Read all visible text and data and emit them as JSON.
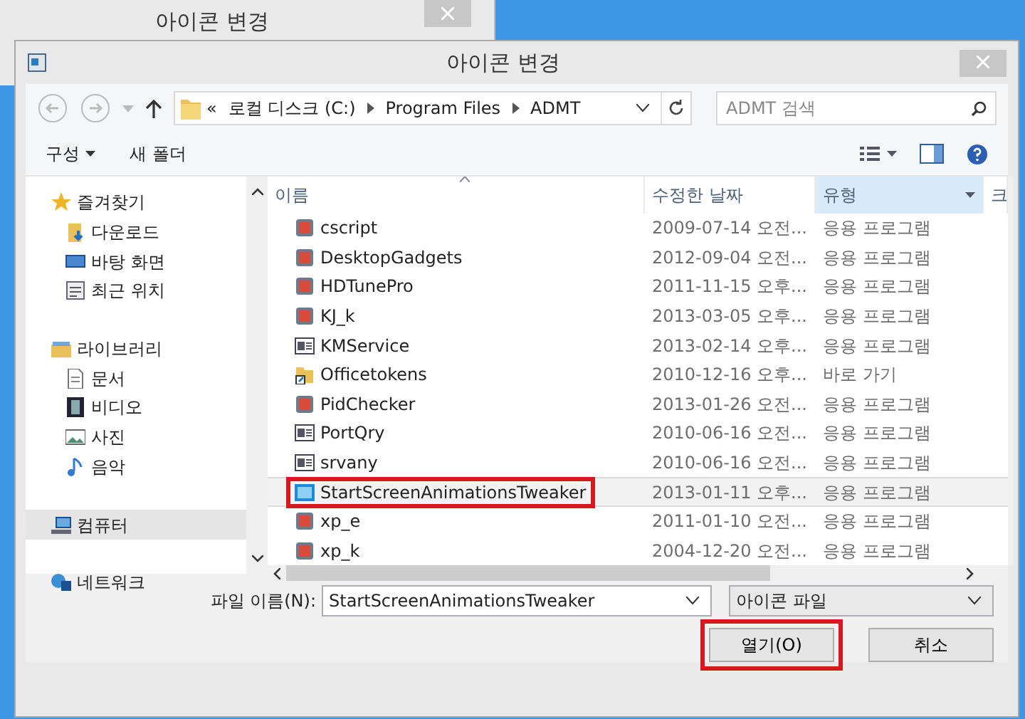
{
  "back_window": {
    "title": "아이콘 변경"
  },
  "dialog": {
    "title": "아이콘 변경"
  },
  "address": {
    "crumbs": [
      "«",
      "로컬 디스크 (C:)",
      "Program Files",
      "ADMT"
    ]
  },
  "search": {
    "placeholder": "ADMT 검색"
  },
  "toolbar": [
    {
      "label": "구성",
      "kind": "menu"
    },
    {
      "label": "새 폴더",
      "kind": "plain"
    }
  ],
  "sidebar": [
    {
      "label": "즐겨찾기",
      "kind": "star",
      "selected": false,
      "children": [
        {
          "label": "다운로드",
          "kind": "download",
          "selected": false
        },
        {
          "label": "바탕 화면",
          "kind": "desktop",
          "selected": false
        },
        {
          "label": "최근 위치",
          "kind": "recent",
          "selected": false
        }
      ]
    },
    {
      "label": "라이브러리",
      "kind": "library",
      "selected": false,
      "children": [
        {
          "label": "문서",
          "kind": "document",
          "selected": false
        },
        {
          "label": "비디오",
          "kind": "video",
          "selected": false
        },
        {
          "label": "사진",
          "kind": "picture",
          "selected": false
        },
        {
          "label": "음악",
          "kind": "music",
          "selected": false
        }
      ]
    },
    {
      "label": "컴퓨터",
      "kind": "computer",
      "selected": true
    },
    {
      "label": "네트워크",
      "kind": "network",
      "selected": false
    }
  ],
  "columns": [
    {
      "label": "이름",
      "sorted": true,
      "hovered": false
    },
    {
      "label": "수정한 날짜",
      "sorted": false,
      "hovered": false
    },
    {
      "label": "유형",
      "sorted": false,
      "hovered": true
    },
    {
      "label": "크",
      "sorted": false,
      "hovered": false
    }
  ],
  "rows": [
    {
      "name": "cscript",
      "date": "2009-07-14 오전...",
      "type": "응용 프로그램",
      "kind": "app",
      "selected": false,
      "annotated": false
    },
    {
      "name": "DesktopGadgets",
      "date": "2012-09-04 오전...",
      "type": "응용 프로그램",
      "kind": "app",
      "selected": false,
      "annotated": false
    },
    {
      "name": "HDTunePro",
      "date": "2011-11-15 오후...",
      "type": "응용 프로그램",
      "kind": "app",
      "selected": false,
      "annotated": false
    },
    {
      "name": "KJ_k",
      "date": "2013-03-05 오후...",
      "type": "응용 프로그램",
      "kind": "app",
      "selected": false,
      "annotated": false
    },
    {
      "name": "KMService",
      "date": "2013-02-14 오후...",
      "type": "응용 프로그램",
      "kind": "window",
      "selected": false,
      "annotated": false
    },
    {
      "name": "Officetokens",
      "date": "2010-12-16 오후...",
      "type": "바로 가기",
      "kind": "shortcut",
      "selected": false,
      "annotated": false
    },
    {
      "name": "PidChecker",
      "date": "2013-01-26 오전...",
      "type": "응용 프로그램",
      "kind": "app",
      "selected": false,
      "annotated": false
    },
    {
      "name": "PortQry",
      "date": "2010-06-16 오전...",
      "type": "응용 프로그램",
      "kind": "window",
      "selected": false,
      "annotated": false
    },
    {
      "name": "srvany",
      "date": "2010-06-16 오전...",
      "type": "응용 프로그램",
      "kind": "window",
      "selected": false,
      "annotated": false
    },
    {
      "name": "StartScreenAnimationsTweaker",
      "date": "2013-01-11 오후...",
      "type": "응용 프로그램",
      "kind": "screen",
      "selected": true,
      "annotated": true
    },
    {
      "name": "xp_e",
      "date": "2011-01-10 오전...",
      "type": "응용 프로그램",
      "kind": "app",
      "selected": false,
      "annotated": false
    },
    {
      "name": "xp_k",
      "date": "2004-12-20 오전...",
      "type": "응용 프로그램",
      "kind": "app",
      "selected": false,
      "annotated": false
    }
  ],
  "filename": {
    "label": "파일 이름(N):",
    "value": "StartScreenAnimationsTweaker"
  },
  "filter": {
    "value": "아이콘 파일"
  },
  "buttons": [
    {
      "label": "열기(O)",
      "annotated": true
    },
    {
      "label": "취소",
      "annotated": false
    }
  ]
}
